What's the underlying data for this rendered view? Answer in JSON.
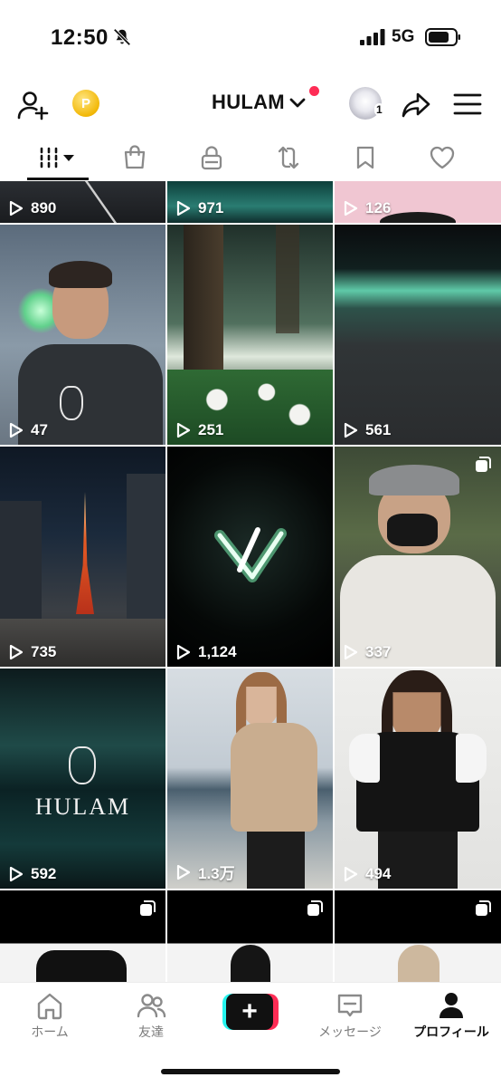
{
  "status": {
    "time": "12:50",
    "network": "5G"
  },
  "header": {
    "username": "HULAM",
    "coin_symbol": "P",
    "avatar_badge": "1"
  },
  "tabs": [
    "videos-grid",
    "shop",
    "private",
    "reposts",
    "favorites",
    "liked"
  ],
  "colors": {
    "accent": "#fe2c55",
    "teal": "#25f4ee",
    "text": "#111111"
  },
  "grid": {
    "items": [
      {
        "views": "890",
        "theme": "road-dark"
      },
      {
        "views": "971",
        "theme": "teal-water"
      },
      {
        "views": "126",
        "theme": "pink-top"
      },
      {
        "views": "47",
        "theme": "portrait-man"
      },
      {
        "views": "251",
        "theme": "forest"
      },
      {
        "views": "561",
        "theme": "aurora-sea"
      },
      {
        "views": "735",
        "theme": "tokyo-tower"
      },
      {
        "views": "1,124",
        "theme": "glowing-logo"
      },
      {
        "views": "337",
        "theme": "man-hoodie",
        "multi": true
      },
      {
        "views": "592",
        "theme": "hulam-water",
        "overlay_text": "HULAM"
      },
      {
        "views": "1.3万",
        "theme": "beige-hoodie"
      },
      {
        "views": "494",
        "theme": "raglan-tee"
      },
      {
        "views": "",
        "theme": "black-tee",
        "multi": true
      },
      {
        "views": "",
        "theme": "black-hoodie",
        "multi": true
      },
      {
        "views": "",
        "theme": "beige-hoodie-2",
        "multi": true
      }
    ]
  },
  "nav": {
    "home": "ホーム",
    "friends": "友達",
    "create": "+",
    "messages": "メッセージ",
    "profile": "プロフィール"
  }
}
